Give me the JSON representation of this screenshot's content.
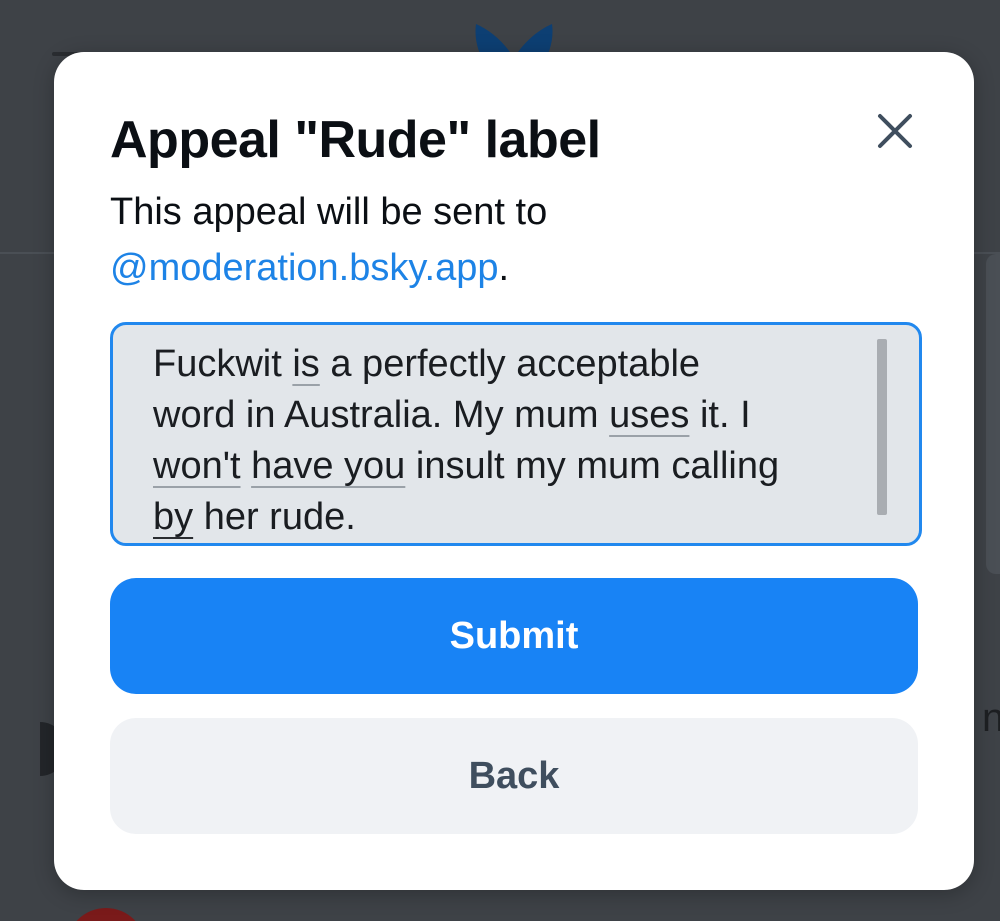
{
  "modal": {
    "title": "Appeal \"Rude\" label",
    "description_prefix": "This appeal will be sent to ",
    "moderation_handle": "@moderation.bsky.app",
    "description_suffix": ".",
    "close_icon": "close-icon"
  },
  "appeal_text": {
    "line1_w1": "Fuckwit",
    "line1_w2": "is",
    "line1_rest": " a perfectly acceptable",
    "line2_a": "word in Australia. My mum ",
    "line2_w": "uses",
    "line2_b": " it. I",
    "line3_w1": "won't",
    "line3_w2": "have you",
    "line3_rest": " insult my mum calling",
    "line4_w": "by",
    "line4_rest": " her rude."
  },
  "buttons": {
    "submit_label": "Submit",
    "back_label": "Back"
  },
  "colors": {
    "accent": "#1883f5",
    "link": "#1d83e6",
    "focus_border": "#2188ee",
    "backdrop": "#3e4247"
  },
  "background_app": {
    "logo_icon": "butterfly-logo-icon",
    "menu_icon": "hamburger-menu-icon"
  }
}
